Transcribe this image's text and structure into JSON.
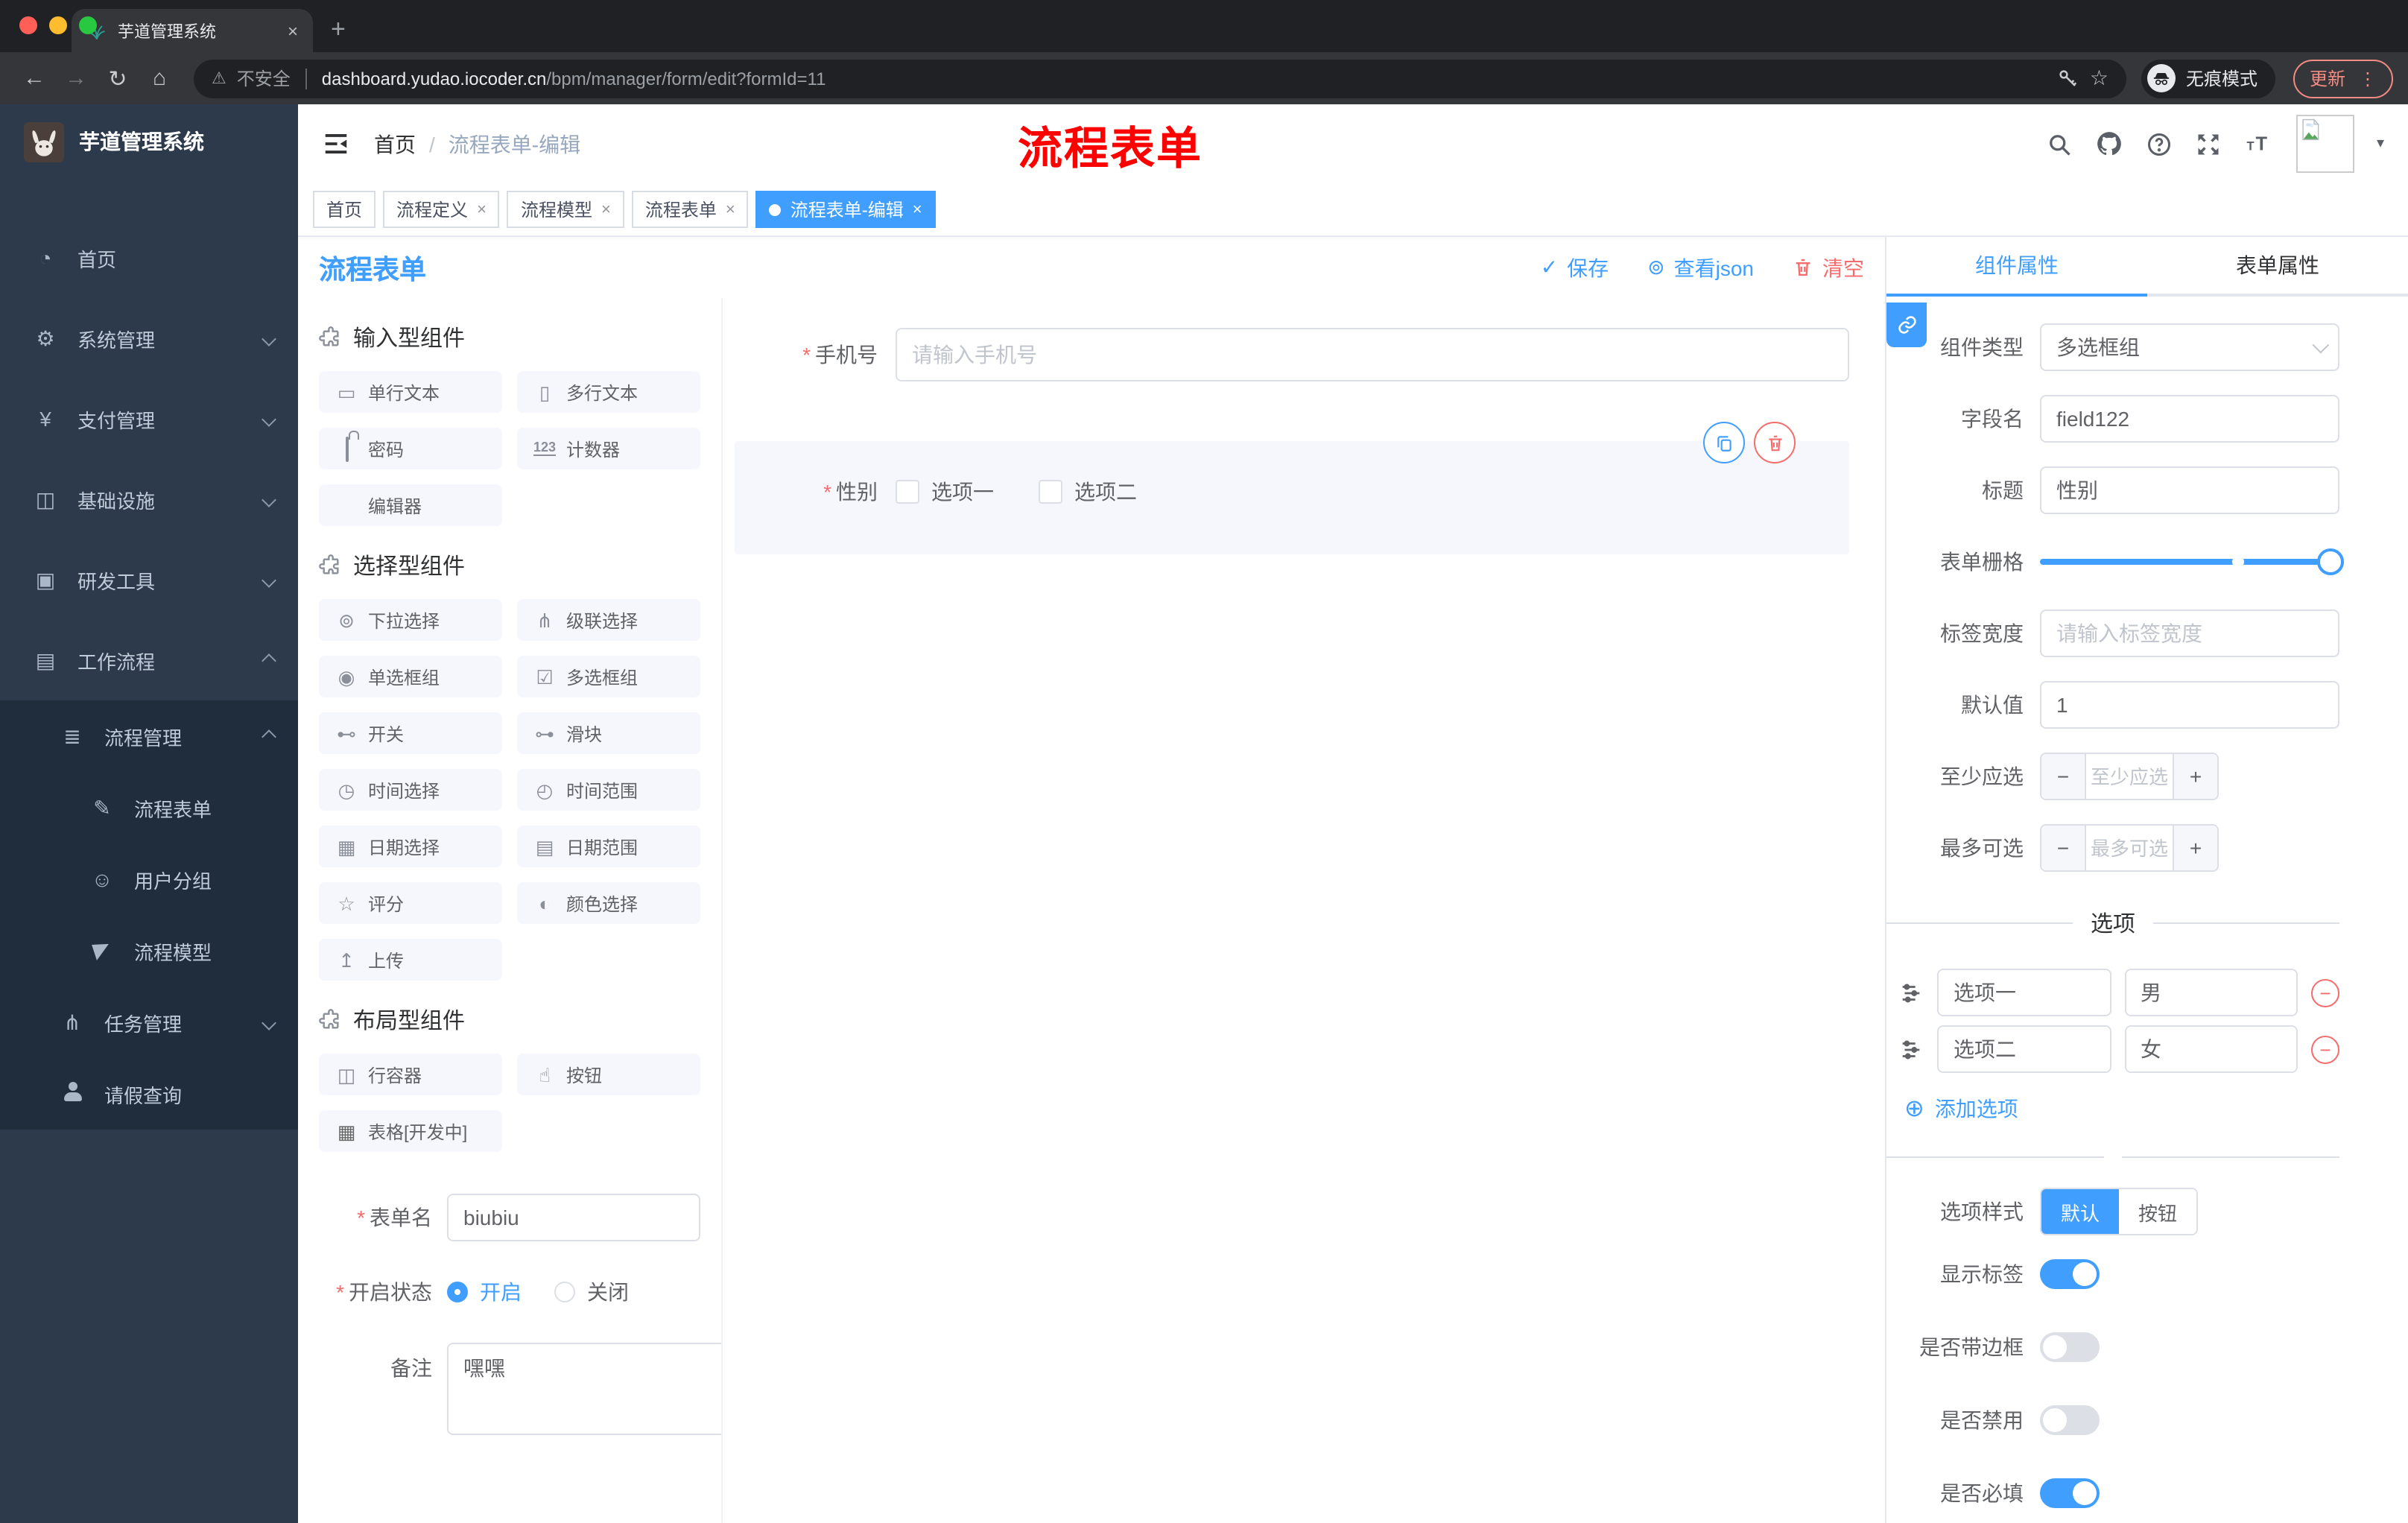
{
  "browser": {
    "tab_title": "芋道管理系统",
    "security": "不安全",
    "url_host": "dashboard.yudao.iocoder.cn",
    "url_path": "/bpm/manager/form/edit?formId=11",
    "incognito": "无痕模式",
    "update": "更新"
  },
  "sidebar": {
    "title": "芋道管理系统",
    "items": [
      {
        "label": "首页"
      },
      {
        "label": "系统管理"
      },
      {
        "label": "支付管理"
      },
      {
        "label": "基础设施"
      },
      {
        "label": "研发工具"
      },
      {
        "label": "工作流程"
      }
    ],
    "submenu": [
      {
        "label": "流程管理"
      },
      {
        "label": "流程表单"
      },
      {
        "label": "用户分组"
      },
      {
        "label": "流程模型"
      },
      {
        "label": "任务管理"
      },
      {
        "label": "请假查询"
      }
    ]
  },
  "header": {
    "breadcrumb_home": "首页",
    "breadcrumb_current": "流程表单-编辑",
    "overlay_title": "流程表单"
  },
  "tags": [
    {
      "label": "首页"
    },
    {
      "label": "流程定义"
    },
    {
      "label": "流程模型"
    },
    {
      "label": "流程表单"
    },
    {
      "label": "流程表单-编辑"
    }
  ],
  "builder": {
    "title": "流程表单",
    "save": "保存",
    "view_json": "查看json",
    "clear": "清空"
  },
  "palette": {
    "sections": [
      {
        "title": "输入型组件",
        "items": [
          {
            "label": "单行文本"
          },
          {
            "label": "多行文本"
          },
          {
            "label": "密码"
          },
          {
            "label": "计数器"
          },
          {
            "label": "编辑器"
          }
        ]
      },
      {
        "title": "选择型组件",
        "items": [
          {
            "label": "下拉选择"
          },
          {
            "label": "级联选择"
          },
          {
            "label": "单选框组"
          },
          {
            "label": "多选框组"
          },
          {
            "label": "开关"
          },
          {
            "label": "滑块"
          },
          {
            "label": "时间选择"
          },
          {
            "label": "时间范围"
          },
          {
            "label": "日期选择"
          },
          {
            "label": "日期范围"
          },
          {
            "label": "评分"
          },
          {
            "label": "颜色选择"
          },
          {
            "label": "上传"
          }
        ]
      },
      {
        "title": "布局型组件",
        "items": [
          {
            "label": "行容器"
          },
          {
            "label": "按钮"
          },
          {
            "label": "表格[开发中]"
          }
        ]
      }
    ]
  },
  "form_meta": {
    "name_label": "表单名",
    "name_value": "biubiu",
    "status_label": "开启状态",
    "status_on": "开启",
    "status_off": "关闭",
    "remark_label": "备注",
    "remark_value": "嘿嘿"
  },
  "canvas": {
    "phone_label": "手机号",
    "phone_placeholder": "请输入手机号",
    "gender_label": "性别",
    "gender_opt1": "选项一",
    "gender_opt2": "选项二"
  },
  "panel": {
    "tab_component": "组件属性",
    "tab_form": "表单属性",
    "component_type_label": "组件类型",
    "component_type_value": "多选框组",
    "field_name_label": "字段名",
    "field_name_value": "field122",
    "title_label": "标题",
    "title_value": "性别",
    "grid_label": "表单栅格",
    "label_width_label": "标签宽度",
    "label_width_placeholder": "请输入标签宽度",
    "default_label": "默认值",
    "default_value": "1",
    "min_label": "至少应选",
    "min_placeholder": "至少应选",
    "max_label": "最多可选",
    "max_placeholder": "最多可选",
    "options_title": "选项",
    "options": [
      {
        "name": "选项一",
        "value": "男"
      },
      {
        "name": "选项二",
        "value": "女"
      }
    ],
    "add_option": "添加选项",
    "style_label": "选项样式",
    "style_default": "默认",
    "style_button": "按钮",
    "toggle_show_label": "显示标签",
    "toggle_border": "是否带边框",
    "toggle_disabled": "是否禁用",
    "toggle_required": "是否必填"
  },
  "colors": {
    "primary": "#409eff",
    "danger": "#f56c6c",
    "overlay_red": "#fe0000",
    "sidebar_bg": "#2d3a4b",
    "submenu_bg": "#1f2d3d"
  },
  "icons": {
    "back": "←",
    "forward": "→",
    "reload": "↻",
    "home": "⌂",
    "warn": "⚠",
    "star": "☆",
    "dots": "⋮",
    "tab_close": "×",
    "new_tab": "+",
    "caret": "▾",
    "check": "✓",
    "eye": "⊚",
    "dashboard": "◔",
    "system": "⚙",
    "pay": "¥",
    "infra": "◫",
    "devtool": "▣",
    "workflow": "▤",
    "flow_mgr": "≣",
    "flow_form": "✎",
    "user_group": "☺",
    "task_mgr": "⋔",
    "single_text": "▭",
    "multi_text": "▯",
    "counter": "123",
    "select": "⊚",
    "cascader": "⋔",
    "radio_group": "◉",
    "checkbox_group": "☑",
    "switch": "⊷",
    "slider": "⊶",
    "time": "◷",
    "time_range": "◴",
    "date": "▦",
    "date_range": "▤",
    "rate": "☆",
    "color": "◐",
    "upload": "↥",
    "row_container": "◫",
    "button": "☝",
    "table": "▦",
    "plus_circle": "⊕",
    "minus": "−"
  }
}
